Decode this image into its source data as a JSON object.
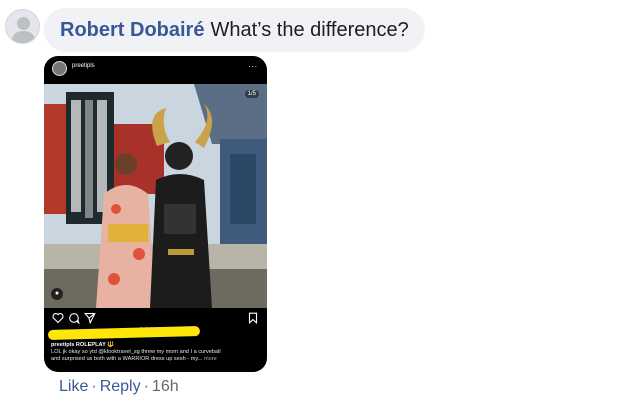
{
  "comment": {
    "author": "Robert Dobairé",
    "text": "What’s the difference?"
  },
  "post": {
    "username": "preetipls",
    "more_icon": "...",
    "counter": "1/5",
    "caption_user": "preetipls ROLEPLAY",
    "caption_line1": "LOL jk okay so ytd @klooktravel_sg threw my mom and I a curveball",
    "caption_line2": "and surprised us both with a WARRIOR dress up sesh - my...",
    "caption_more": "more",
    "carousel_total": 5,
    "carousel_active": 1
  },
  "actions": {
    "like": "Like",
    "reply": "Reply",
    "separator": "·",
    "time": "16h"
  },
  "icons": [
    "profile-placeholder-icon",
    "heart-icon",
    "comment-icon",
    "share-icon",
    "bookmark-icon",
    "tag-user-icon"
  ],
  "colors": {
    "link": "#385898",
    "bubble": "#f0f2f5",
    "highlighter": "#ffe60a"
  }
}
